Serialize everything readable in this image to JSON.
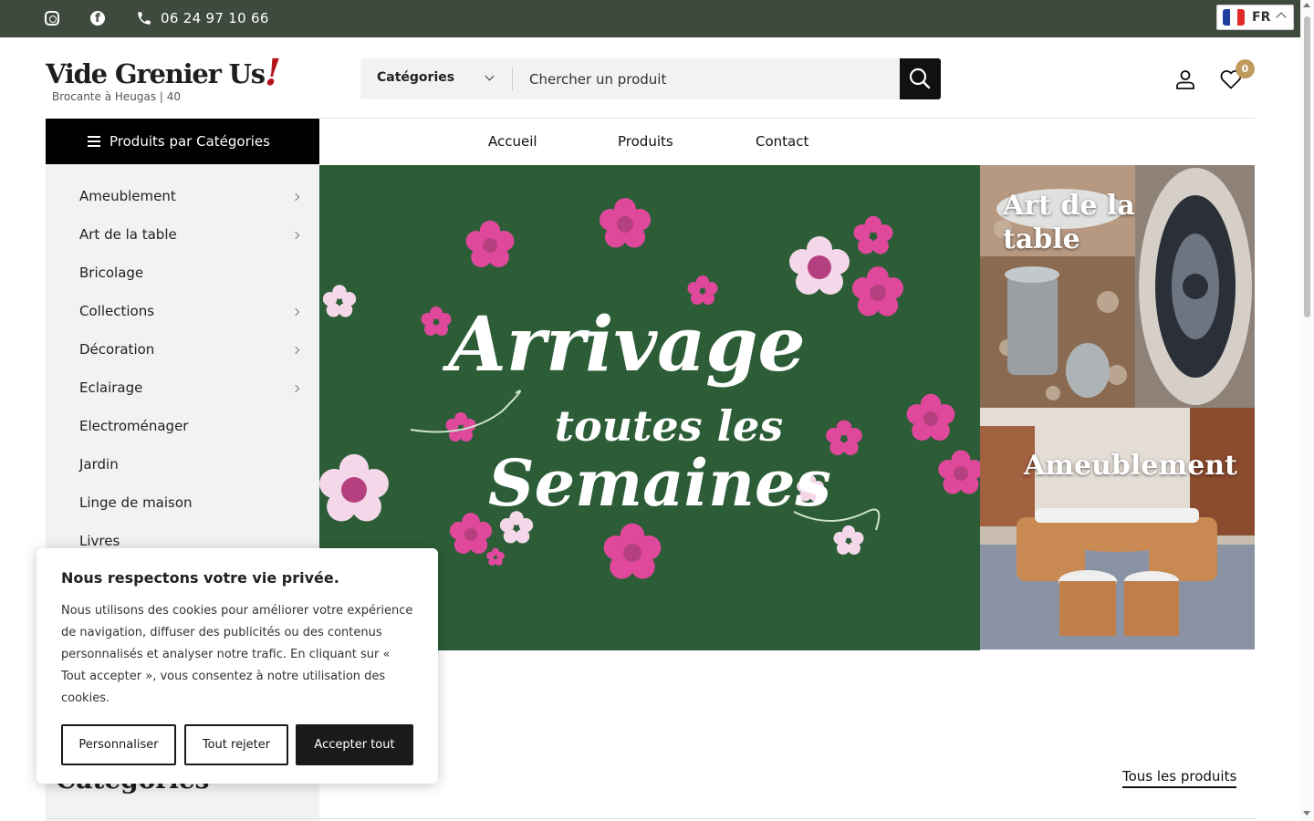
{
  "topbar": {
    "phone": "06 24 97 10 66",
    "language": {
      "code": "FR"
    }
  },
  "header": {
    "logo_title": "Vide Grenier Us",
    "logo_mark": "!",
    "logo_subtitle": "Brocante à Heugas | 40",
    "search": {
      "category_label": "Catégories",
      "placeholder": "Chercher un produit"
    },
    "wishlist_count": "0"
  },
  "nav": {
    "categories_button": "Produits par Catégories",
    "menu": [
      "Accueil",
      "Produits",
      "Contact"
    ]
  },
  "sidebar": {
    "items": [
      {
        "label": "Ameublement",
        "has_sub": true
      },
      {
        "label": "Art de la table",
        "has_sub": true
      },
      {
        "label": "Bricolage",
        "has_sub": false
      },
      {
        "label": "Collections",
        "has_sub": true
      },
      {
        "label": "Décoration",
        "has_sub": true
      },
      {
        "label": "Eclairage",
        "has_sub": true
      },
      {
        "label": "Electroménager",
        "has_sub": false
      },
      {
        "label": "Jardin",
        "has_sub": false
      },
      {
        "label": "Linge de maison",
        "has_sub": false
      },
      {
        "label": "Livres",
        "has_sub": false
      }
    ]
  },
  "banner": {
    "line1": "Arrivage",
    "line2": "toutes les",
    "line3": "Semaines"
  },
  "tiles": {
    "table": {
      "line1": "Art de la",
      "line2": "table"
    },
    "furniture": "Ameublement"
  },
  "section": {
    "heading": "Catégories",
    "all_products_link": "Tous les produits"
  },
  "cookie": {
    "title": "Nous respectons votre vie privée.",
    "text": "Nous utilisons des cookies pour améliorer votre expérience de navigation, diffuser des publicités ou des contenus personnalisés et analyser notre trafic. En cliquant sur « Tout accepter », vous consentez à notre utilisation des cookies.",
    "customize": "Personnaliser",
    "reject": "Tout rejeter",
    "accept": "Accepter tout"
  },
  "colors": {
    "topbar_bg": "#3f4a3f",
    "banner_green": "#2c5d37",
    "accent_gold": "#c09a5c",
    "logo_red": "#b3151b"
  }
}
